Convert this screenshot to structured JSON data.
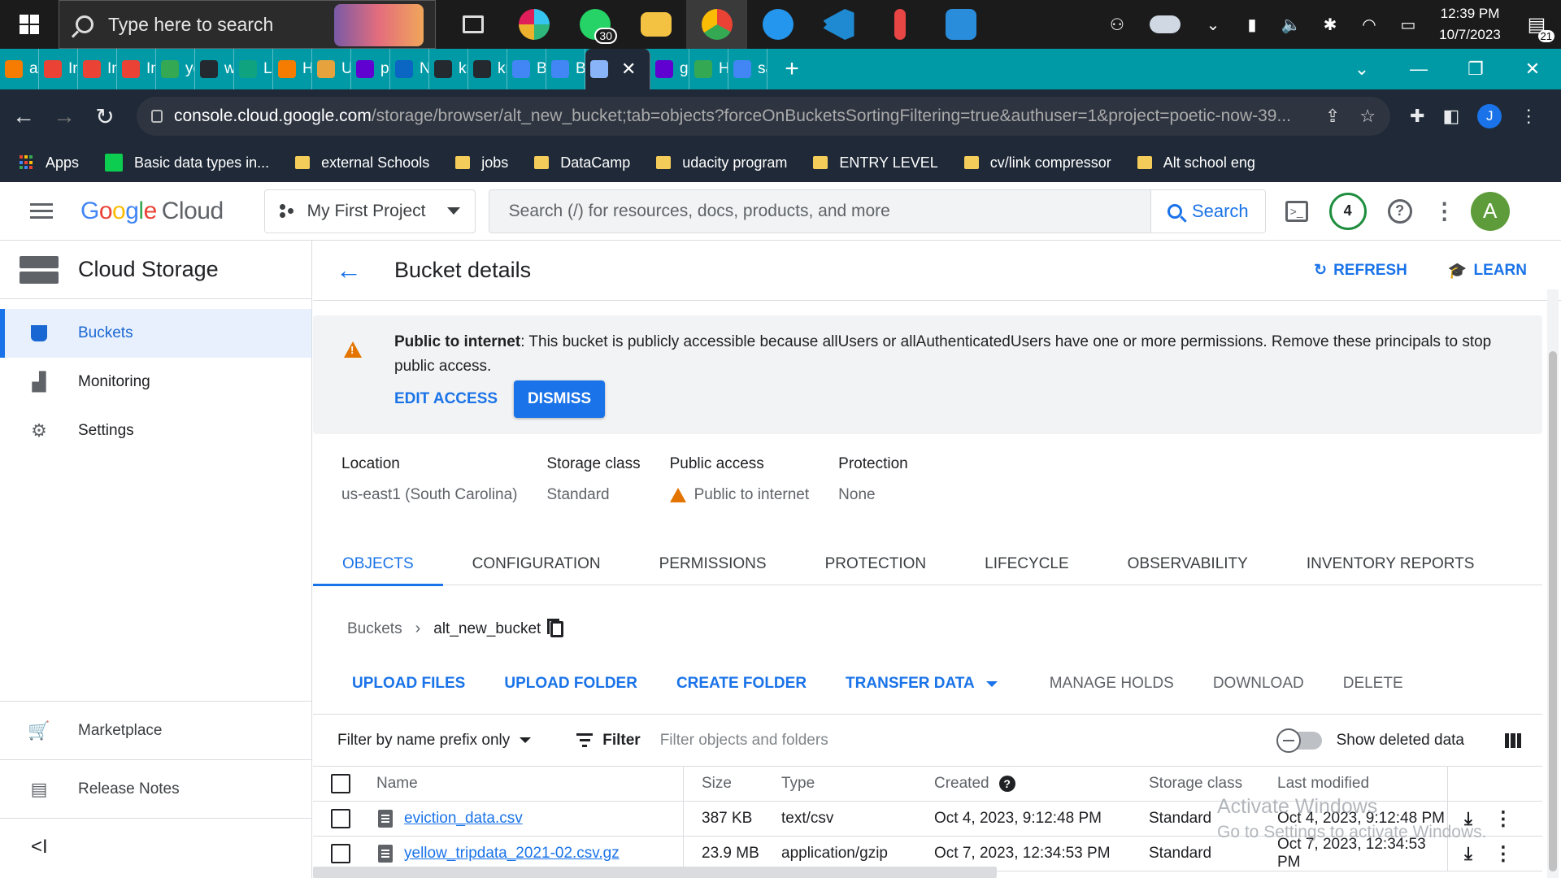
{
  "taskbar": {
    "search_placeholder": "Type here to search",
    "whatsapp_badge": "30",
    "time": "12:39 PM",
    "date": "10/7/2023",
    "notifications": "21"
  },
  "browser": {
    "tabs": [
      "az",
      "Inl",
      "Inl",
      "Inl",
      "ye",
      "we",
      "Lo",
      "Hc",
      "Ur",
      "py",
      "Nc",
      "kri",
      "kri",
      "Bi",
      "Bi",
      "",
      "gc",
      "Hc",
      "sa"
    ],
    "url_host": "console.cloud.google.com",
    "url_path": "/storage/browser/alt_new_bucket;tab=objects?forceOnBucketsSortingFiltering=true&authuser=1&project=poetic-now-39...",
    "profile_initial": "J",
    "bookmarks": [
      "Apps",
      "Basic data types in...",
      "external Schools",
      "jobs",
      "DataCamp",
      "udacity program",
      "ENTRY LEVEL",
      "cv/link compressor",
      "Alt school eng"
    ]
  },
  "header": {
    "logo_google": "Google",
    "logo_cloud": "Cloud",
    "project": "My First Project",
    "search_placeholder": "Search (/) for resources, docs, products, and more",
    "search_button": "Search",
    "notif_count": "4",
    "avatar": "A"
  },
  "sidebar": {
    "title": "Cloud Storage",
    "items": [
      {
        "label": "Buckets"
      },
      {
        "label": "Monitoring"
      },
      {
        "label": "Settings"
      }
    ],
    "bottom": [
      {
        "label": "Marketplace"
      },
      {
        "label": "Release Notes"
      }
    ],
    "collapse": "<I"
  },
  "page": {
    "title": "Bucket details",
    "refresh": "REFRESH",
    "learn": "LEARN"
  },
  "banner": {
    "bold": "Public to internet",
    "text": ": This bucket is publicly accessible because allUsers or allAuthenticatedUsers have one or more permissions. Remove these principals to stop public access.",
    "edit_access": "EDIT ACCESS",
    "dismiss": "DISMISS"
  },
  "props": [
    {
      "key": "Location",
      "value": "us-east1 (South Carolina)"
    },
    {
      "key": "Storage class",
      "value": "Standard"
    },
    {
      "key": "Public access",
      "value": "Public to internet"
    },
    {
      "key": "Protection",
      "value": "None"
    }
  ],
  "tabs": [
    "OBJECTS",
    "CONFIGURATION",
    "PERMISSIONS",
    "PROTECTION",
    "LIFECYCLE",
    "OBSERVABILITY",
    "INVENTORY REPORTS"
  ],
  "breadcrumb": {
    "root": "Buckets",
    "bucket": "alt_new_bucket"
  },
  "actions": [
    "UPLOAD FILES",
    "UPLOAD FOLDER",
    "CREATE FOLDER",
    "TRANSFER DATA",
    "MANAGE HOLDS",
    "DOWNLOAD",
    "DELETE"
  ],
  "filter": {
    "mode": "Filter by name prefix only",
    "button": "Filter",
    "placeholder": "Filter objects and folders",
    "show_deleted": "Show deleted data"
  },
  "table": {
    "headers": [
      "Name",
      "Size",
      "Type",
      "Created",
      "Storage class",
      "Last modified"
    ],
    "rows": [
      {
        "name": "eviction_data.csv",
        "size": "387 KB",
        "type": "text/csv",
        "created": "Oct 4, 2023, 9:12:48 PM",
        "class": "Standard",
        "modified": "Oct 4, 2023, 9:12:48 PM"
      },
      {
        "name": "yellow_tripdata_2021-02.csv.gz",
        "size": "23.9 MB",
        "type": "application/gzip",
        "created": "Oct 7, 2023, 12:34:53 PM",
        "class": "Standard",
        "modified": "Oct 7, 2023, 12:34:53 PM"
      }
    ]
  },
  "watermark": {
    "line1": "Activate Windows",
    "line2": "Go to Settings to activate Windows."
  }
}
